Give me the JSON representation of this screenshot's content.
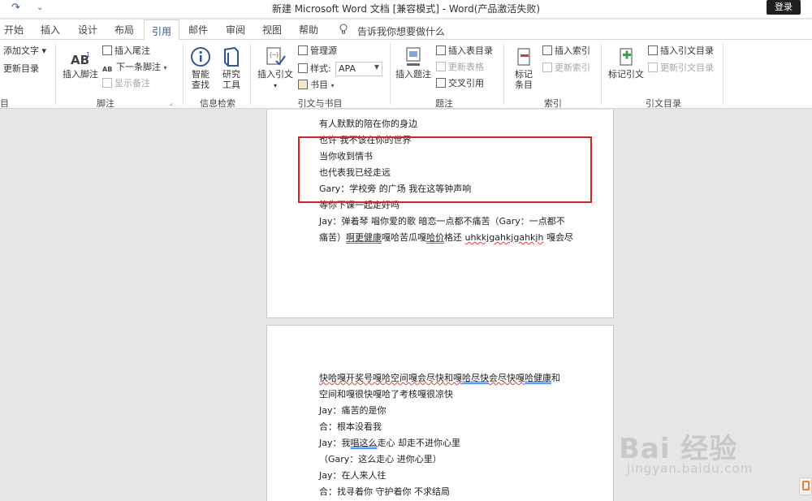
{
  "titlebar": {
    "title": "新建 Microsoft Word 文档 [兼容模式]  -  Word(产品激活失败)",
    "login": "登录",
    "qa_redo": "↷",
    "qa_more": "⌄"
  },
  "tabs": [
    {
      "label": "开始"
    },
    {
      "label": "插入"
    },
    {
      "label": "设计"
    },
    {
      "label": "布局"
    },
    {
      "label": "引用"
    },
    {
      "label": "邮件"
    },
    {
      "label": "审阅"
    },
    {
      "label": "视图"
    },
    {
      "label": "帮助"
    }
  ],
  "tellme": "告诉我你想要做什么",
  "ribbon": {
    "toc": {
      "add_text": "添加文字 ▾",
      "update": "更新目录",
      "group": "目录"
    },
    "footnote": {
      "insert_footnote": "插入脚注",
      "insert_endnote": "插入尾注",
      "next_footnote": "下一条脚注",
      "show_notes": "显示备注",
      "group": "脚注"
    },
    "research": {
      "smart_lookup_1": "智能",
      "smart_lookup_2": "查找",
      "research_1": "研究",
      "research_2": "工具",
      "group": "信息检索"
    },
    "citations": {
      "insert_citation": "插入引文",
      "manage_sources": "管理源",
      "style_label": "样式:",
      "style_value": "APA",
      "bibliography": "书目",
      "group": "引文与书目"
    },
    "captions": {
      "insert_caption": "插入题注",
      "insert_table_figures": "插入表目录",
      "update_table": "更新表格",
      "cross_reference": "交叉引用",
      "group": "题注"
    },
    "index": {
      "mark_entry_1": "标记",
      "mark_entry_2": "条目",
      "insert_index": "插入索引",
      "update_index": "更新索引",
      "group": "索引"
    },
    "toa": {
      "mark_citation": "标记引文",
      "insert_toa": "插入引文目录",
      "update_toa": "更新引文目录",
      "group": "引文目录"
    }
  },
  "page1": {
    "lines": [
      "有人默默的陪在你的身边",
      "也许  我不该在你的世界",
      "当你收到情书",
      "也代表我已经走远",
      "Gary：学校旁  的广场  我在这等钟声响",
      "等你下课一起走好吗",
      "Jay：弹着琴  唱你爱的歌  暗恋一点都不痛苦（Gary：一点都不"
    ],
    "last_line_a": "痛苦）",
    "last_line_b": "啊更健康",
    "last_line_c": "嘎哈苦瓜嘎",
    "last_line_d": "哈价",
    "last_line_e": "格还 ",
    "last_line_f": "uhkkjgahkjgahkjh",
    "last_line_g": " 嘎会尽"
  },
  "page2": {
    "line1_a": "快哈嘎开奖号嘎哈空间嘎会尽快和嘎",
    "line1_b": "哈尽快",
    "line1_c": "会尽快嘎",
    "line1_d": "哈健康",
    "line1_e": "和",
    "lines": [
      "空间和嘎很快嘎哈了考核嘎很凉快",
      "Jay：痛苦的是你",
      "合：根本没看我"
    ],
    "line5_a": "Jay：我",
    "line5_b": "唱这么",
    "line5_c": "走心  却走不进你心里",
    "lines_after": [
      "（Gary：这么走心  进你心里）",
      "Jay：在人来人往",
      "合：找寻着你  守护着你  不求结局"
    ]
  },
  "watermark": {
    "logo": "Bai 经验",
    "url": "jingyan.baidu.com"
  },
  "colors": {
    "accent": "#2b579a",
    "highlight": "#e02020"
  }
}
